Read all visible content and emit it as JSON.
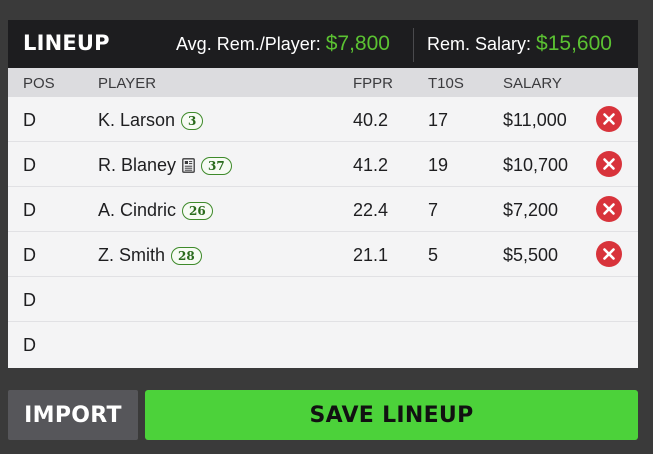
{
  "header": {
    "title": "LINEUP",
    "avg_label": "Avg. Rem./Player:",
    "avg_value": "$7,800",
    "rem_label": "Rem. Salary:",
    "rem_value": "$15,600"
  },
  "columns": {
    "pos": "POS",
    "player": "PLAYER",
    "fppr": "FPPR",
    "t10s": "T10S",
    "salary": "SALARY"
  },
  "rows": [
    {
      "pos": "D",
      "player": "K. Larson",
      "number": "3",
      "news_icon": false,
      "fppr": "40.2",
      "t10s": "17",
      "salary": "$11,000"
    },
    {
      "pos": "D",
      "player": "R. Blaney",
      "number": "37",
      "news_icon": true,
      "fppr": "41.2",
      "t10s": "19",
      "salary": "$10,700"
    },
    {
      "pos": "D",
      "player": "A. Cindric",
      "number": "26",
      "news_icon": false,
      "fppr": "22.4",
      "t10s": "7",
      "salary": "$7,200"
    },
    {
      "pos": "D",
      "player": "Z. Smith",
      "number": "28",
      "news_icon": false,
      "fppr": "21.1",
      "t10s": "5",
      "salary": "$5,500"
    },
    {
      "pos": "D"
    },
    {
      "pos": "D"
    }
  ],
  "buttons": {
    "import": "IMPORT",
    "save": "SAVE LINEUP"
  },
  "icons": {
    "remove": "remove-circle-x-icon",
    "news": "news-document-icon"
  },
  "colors": {
    "accent_green": "#5bc232",
    "save_button": "#4cd23a",
    "remove_red": "#d8333b",
    "header_bg": "#1d1d1f"
  }
}
